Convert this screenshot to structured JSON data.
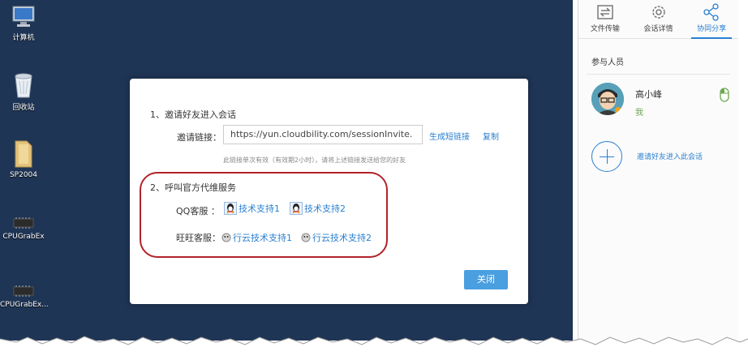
{
  "desktop": {
    "icons": [
      {
        "label": "计算机",
        "icon": "computer-icon"
      },
      {
        "label": "回收站",
        "icon": "recycle-bin-icon"
      },
      {
        "label": "SP2004",
        "icon": "folder-icon"
      },
      {
        "label": "CPUGrabEx",
        "icon": "chip-icon"
      },
      {
        "label": "CPUGrabEx...",
        "icon": "chip-icon"
      }
    ]
  },
  "panel": {
    "tabs": [
      {
        "label": "文件传输",
        "icon": "file-transfer-icon"
      },
      {
        "label": "会话详情",
        "icon": "gear-icon"
      },
      {
        "label": "协同分享",
        "icon": "share-icon"
      }
    ],
    "participants_title": "参与人员",
    "member": {
      "name": "高小峰",
      "tag": "我"
    },
    "invite_text": "邀请好友进入此会话"
  },
  "dialog": {
    "section1_title": "1、邀请好友进入会话",
    "invite_link_label": "邀请链接：",
    "invite_link_value": "https://yun.cloudbility.com/sessionInvite.",
    "generate_short_link": "生成短链接",
    "copy": "复制",
    "note": "此链接单次有效（有效期2小时），请将上述链接发送给您的好友",
    "section2_title": "2、呼叫官方代维服务",
    "qq_label": "QQ客服 ：",
    "qq_support_1": "技术支持1",
    "qq_support_2": "技术支持2",
    "wangwang_label": "旺旺客服：",
    "wangwang_support_1": "行云技术支持1",
    "wangwang_support_2": "行云技术支持2",
    "close": "关闭"
  },
  "colors": {
    "desktop_bg": "#1f3555",
    "link": "#2a7fd0",
    "button": "#4a9fe0",
    "highlight": "#b2222a"
  }
}
